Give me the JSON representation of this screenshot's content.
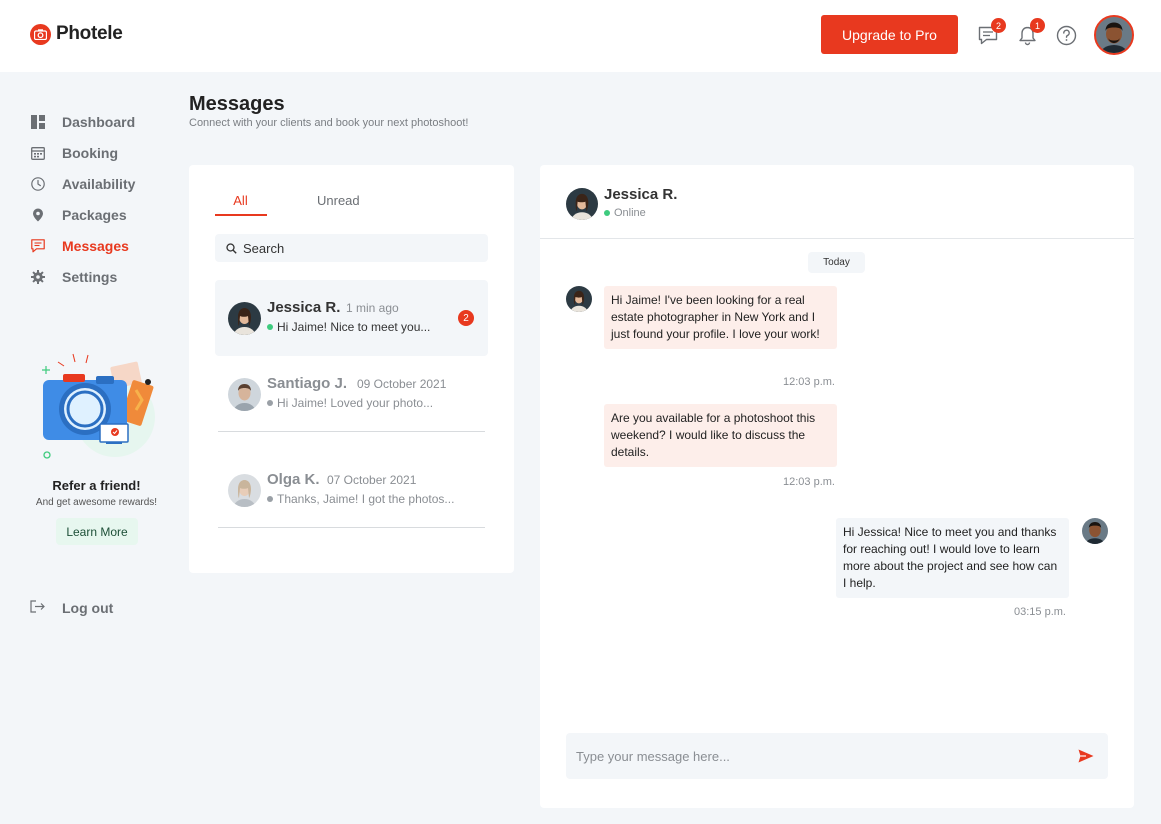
{
  "header": {
    "brand": "Photele",
    "upgrade_label": "Upgrade to Pro",
    "messages_badge": "2",
    "notifications_badge": "1"
  },
  "sidebar": {
    "items": [
      {
        "label": "Dashboard",
        "icon": "dashboard-icon"
      },
      {
        "label": "Booking",
        "icon": "calendar-icon"
      },
      {
        "label": "Availability",
        "icon": "clock-icon"
      },
      {
        "label": "Packages",
        "icon": "location-pin-icon"
      },
      {
        "label": "Messages",
        "icon": "message-icon",
        "active": true
      },
      {
        "label": "Settings",
        "icon": "gear-icon"
      }
    ],
    "refer": {
      "title": "Refer a friend!",
      "subtitle": "And get awesome rewards!",
      "button": "Learn More"
    },
    "logout": "Log out"
  },
  "page": {
    "title": "Messages",
    "subtitle": "Connect with your clients and book your next photoshoot!"
  },
  "conversations": {
    "tabs": [
      "All",
      "Unread"
    ],
    "search_placeholder": "Search",
    "items": [
      {
        "name": "Jessica R.",
        "time": "1 min ago",
        "preview": "Hi Jaime! Nice to meet you...",
        "unread": "2",
        "online": true
      },
      {
        "name": "Santiago J.",
        "time": "09 October 2021",
        "preview": "Hi Jaime! Loved your photo...",
        "online": false
      },
      {
        "name": "Olga K.",
        "time": "07 October 2021",
        "preview": "Thanks, Jaime! I got the photos...",
        "online": false
      }
    ]
  },
  "chat": {
    "name": "Jessica R.",
    "status": "Online",
    "day": "Today",
    "messages": [
      {
        "from": "in",
        "text": "Hi Jaime! I've been looking for a real estate photographer in New York and I just found your profile. I love your work!",
        "time": "12:03 p.m."
      },
      {
        "from": "in",
        "text": "Are you available for a photoshoot this weekend? I would like to discuss the details.",
        "time": "12:03 p.m."
      },
      {
        "from": "out",
        "text": "Hi Jessica! Nice to meet you and thanks for reaching out! I would love to learn more about the project and see how can I help.",
        "time": "03:15 p.m."
      }
    ],
    "composer_placeholder": "Type your message here..."
  },
  "colors": {
    "accent": "#e8391f",
    "online": "#3ecb7e",
    "incoming_bubble": "#fdeeea",
    "outgoing_bubble": "#f3f6f9"
  }
}
